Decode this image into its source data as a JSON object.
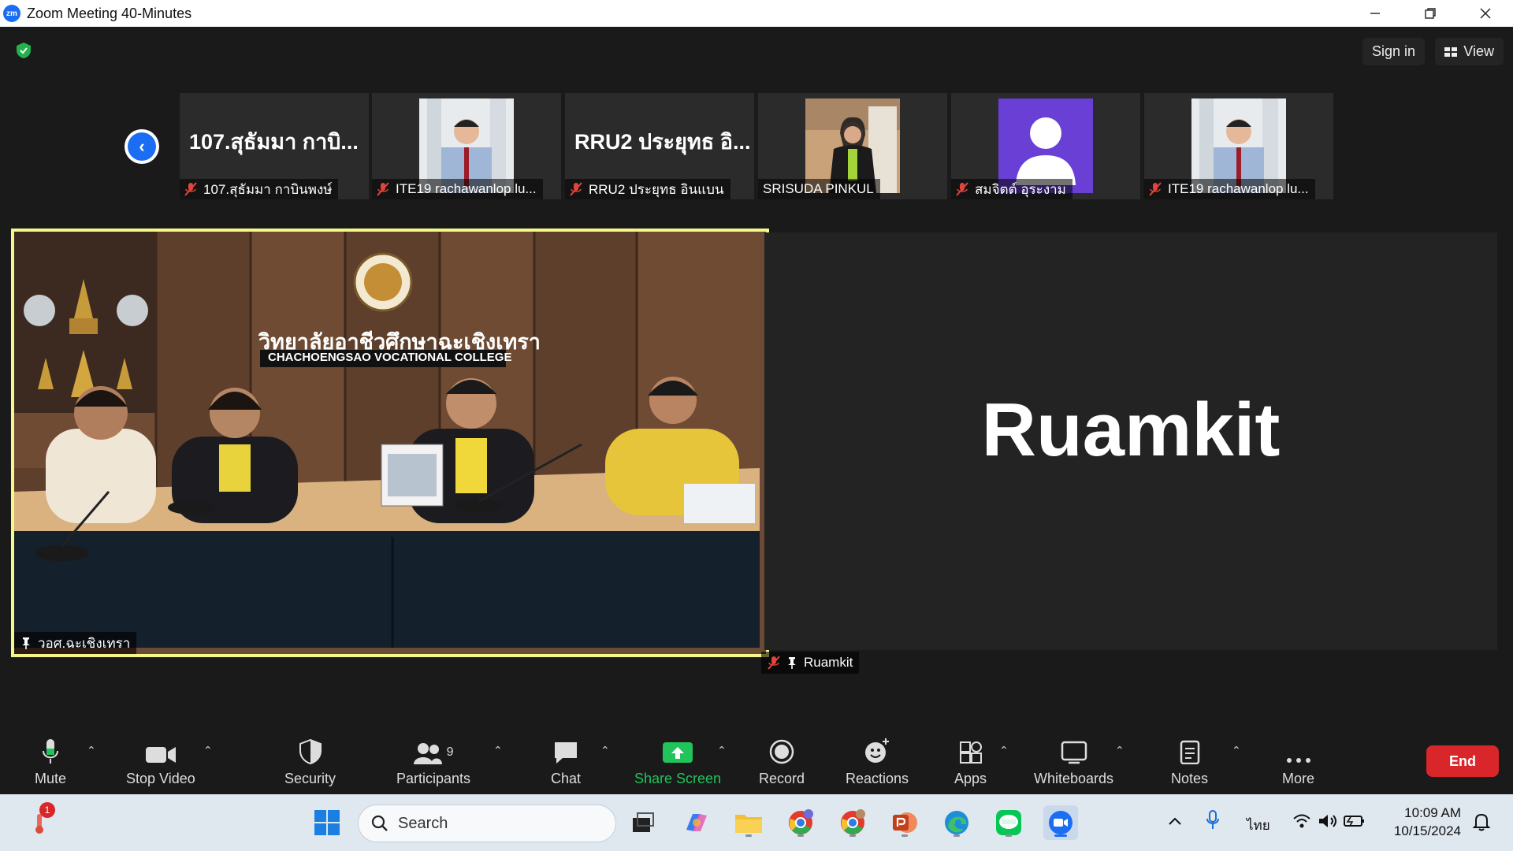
{
  "window": {
    "title": "Zoom Meeting 40-Minutes",
    "logo_text": "zm"
  },
  "header": {
    "sign_in_label": "Sign in",
    "view_label": "View"
  },
  "thumbnails": [
    {
      "big_name": "107.สุธัมมา กาบิ...",
      "caption": "107.สุธัมมา กาบินพงษ์",
      "muted": true,
      "type": "name"
    },
    {
      "caption": "ITE19 rachawanlop lu...",
      "muted": true,
      "type": "photo"
    },
    {
      "big_name": "RRU2 ประยุทธ อิ...",
      "caption": "RRU2 ประยุทธ อินแบน",
      "muted": true,
      "type": "name"
    },
    {
      "caption": "SRISUDA PINKUL",
      "muted": false,
      "type": "photo"
    },
    {
      "caption": "สมจิตต์ อุระงาม",
      "muted": true,
      "type": "avatar"
    },
    {
      "caption": "ITE19 rachawanlop lu...",
      "muted": true,
      "type": "photo"
    }
  ],
  "main_tiles": {
    "left": {
      "label": "วอศ.ฉะเชิงเทรา",
      "sign_thai": "วิทยาลัยอาชีวศึกษาฉะเชิงเทรา",
      "sign_english": "CHACHOENGSAO VOCATIONAL COLLEGE"
    },
    "right": {
      "big_name": "Ruamkit",
      "label": "Ruamkit"
    }
  },
  "toolbar": {
    "mute": "Mute",
    "stop_video": "Stop Video",
    "security": "Security",
    "participants": "Participants",
    "participants_count": "9",
    "chat": "Chat",
    "share_screen": "Share Screen",
    "record": "Record",
    "reactions": "Reactions",
    "apps": "Apps",
    "whiteboards": "Whiteboards",
    "notes": "Notes",
    "more": "More",
    "end": "End"
  },
  "taskbar": {
    "search_placeholder": "Search",
    "notification_count": "1",
    "language": "ไทย",
    "time": "10:09 AM",
    "date": "10/15/2024"
  },
  "colors": {
    "active_speaker_border": "#f4f88a",
    "share_green": "#21c35b",
    "end_red": "#d8262b",
    "zoom_blue": "#1b6ef3"
  }
}
